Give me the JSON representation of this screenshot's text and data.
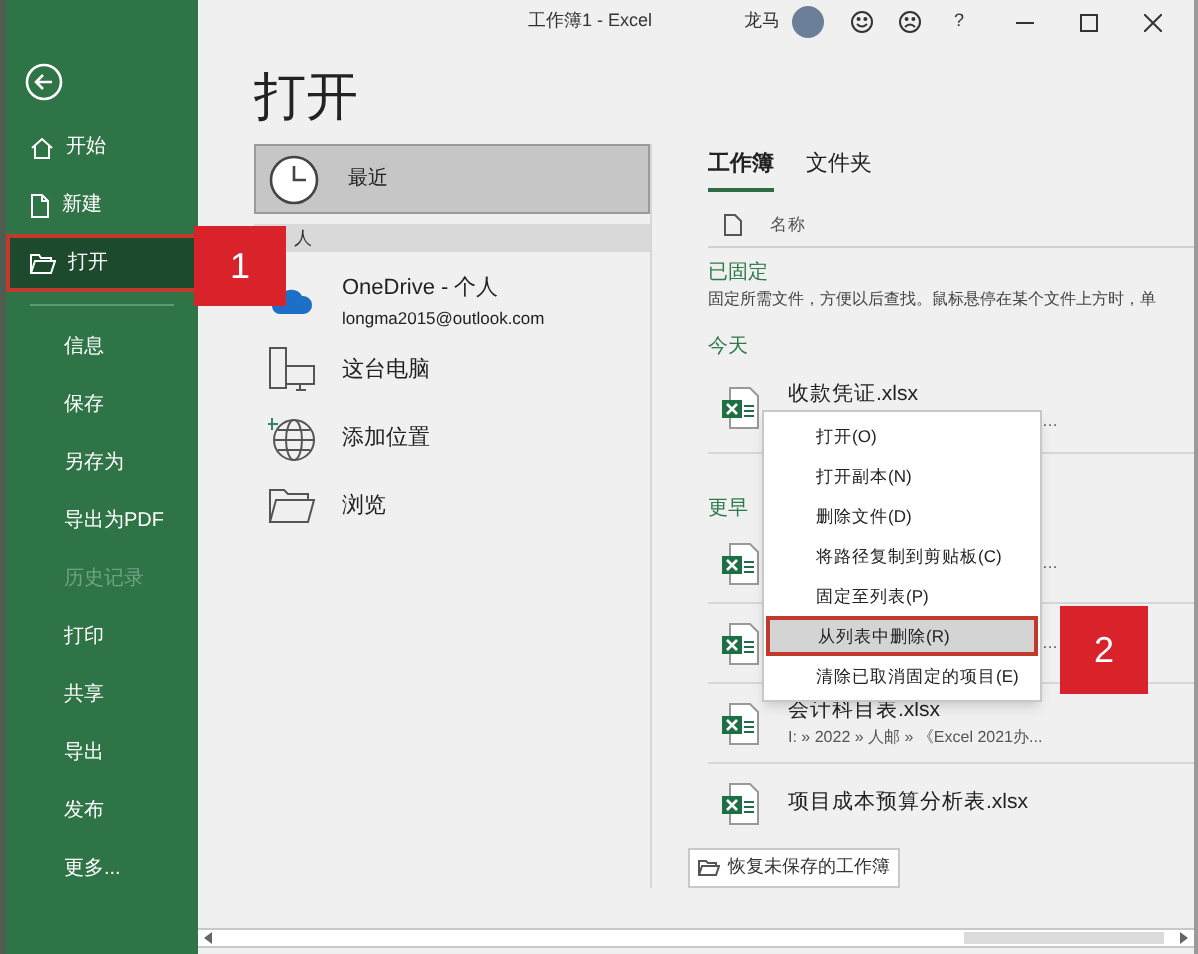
{
  "title_bar": {
    "title": "工作簿1 - Excel",
    "user": "龙马",
    "help": "?"
  },
  "sidebar": {
    "items": [
      {
        "label": "开始",
        "kind": "home",
        "selected": false,
        "disabled": false
      },
      {
        "label": "新建",
        "kind": "new",
        "selected": false,
        "disabled": false
      },
      {
        "label": "打开",
        "kind": "open",
        "selected": true,
        "disabled": false
      },
      {
        "label": "信息",
        "kind": "plain",
        "selected": false,
        "disabled": false
      },
      {
        "label": "保存",
        "kind": "plain",
        "selected": false,
        "disabled": false
      },
      {
        "label": "另存为",
        "kind": "plain",
        "selected": false,
        "disabled": false
      },
      {
        "label": "导出为PDF",
        "kind": "plain",
        "selected": false,
        "disabled": false
      },
      {
        "label": "历史记录",
        "kind": "plain",
        "selected": false,
        "disabled": true
      },
      {
        "label": "打印",
        "kind": "plain",
        "selected": false,
        "disabled": false
      },
      {
        "label": "共享",
        "kind": "plain",
        "selected": false,
        "disabled": false
      },
      {
        "label": "导出",
        "kind": "plain",
        "selected": false,
        "disabled": false
      },
      {
        "label": "发布",
        "kind": "plain",
        "selected": false,
        "disabled": false
      },
      {
        "label": "更多...",
        "kind": "plain",
        "selected": false,
        "disabled": false
      }
    ]
  },
  "page_title": "打开",
  "locations": [
    {
      "kind": "recent",
      "label": "最近",
      "selected": true
    },
    {
      "kind": "header",
      "label": "人"
    },
    {
      "kind": "cloud",
      "label": "OneDrive - 个人",
      "sub": "longma2015@outlook.com",
      "selected": false
    },
    {
      "kind": "pc",
      "label": "这台电脑",
      "selected": false
    },
    {
      "kind": "add",
      "label": "添加位置",
      "selected": false
    },
    {
      "kind": "browse",
      "label": "浏览",
      "selected": false
    }
  ],
  "tabs": [
    {
      "label": "工作簿",
      "selected": true
    },
    {
      "label": "文件夹",
      "selected": false
    }
  ],
  "column_header": "名称",
  "pinned": {
    "heading": "已固定",
    "description": "固定所需文件，方便以后查找。鼠标悬停在某个文件上方时，单"
  },
  "groups": [
    {
      "heading": "今天",
      "files": [
        {
          "name": "收款凭证.xlsx",
          "path": "…",
          "kind": "covered"
        }
      ]
    },
    {
      "heading": "更早",
      "files": [
        {
          "path": "…",
          "kind": "covered"
        },
        {
          "path": "…",
          "kind": "covered"
        },
        {
          "name": "会计科目表.xlsx",
          "path": "I: » 2022 » 人邮 » 《Excel 2021办..."
        },
        {
          "name": "项目成本预算分析表.xlsx"
        }
      ]
    }
  ],
  "recover_button": "恢复未保存的工作簿",
  "context_menu": {
    "items": [
      {
        "label": "打开(O)",
        "selected": false
      },
      {
        "label": "打开副本(N)",
        "selected": false
      },
      {
        "label": "删除文件(D)",
        "selected": false
      },
      {
        "label": "将路径复制到剪贴板(C)",
        "selected": false
      },
      {
        "label": "固定至列表(P)",
        "selected": false
      },
      {
        "label": "从列表中删除(R)",
        "selected": true
      },
      {
        "label": "清除已取消固定的项目(E)",
        "selected": false
      }
    ]
  },
  "callouts": [
    "1",
    "2"
  ]
}
